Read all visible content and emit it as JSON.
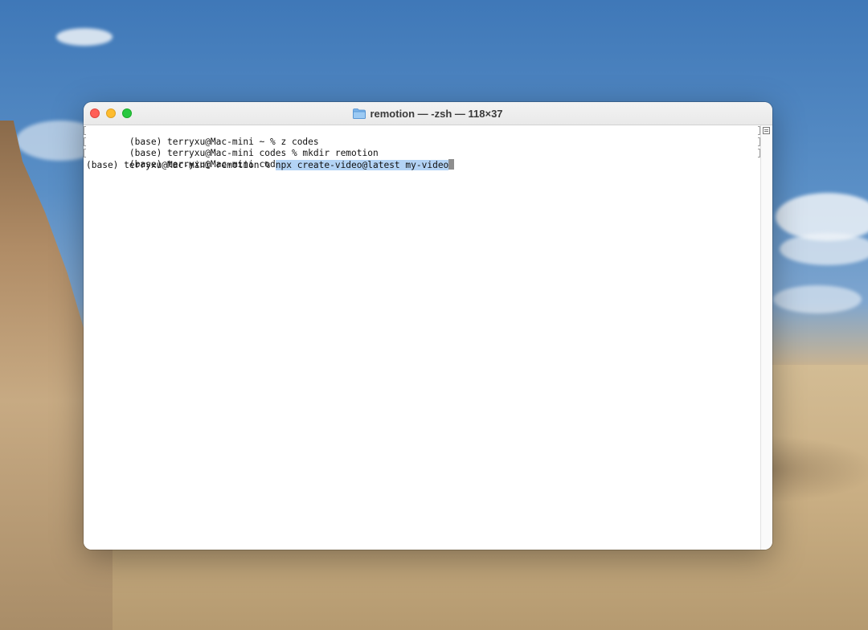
{
  "window": {
    "title": "remotion — -zsh — 118×37",
    "folder_icon": "folder-icon"
  },
  "terminal": {
    "lines": [
      {
        "text": "(base) terryxu@Mac-mini ~ % z codes"
      },
      {
        "text": "(base) terryxu@Mac-mini codes % mkdir remotion"
      },
      {
        "text": "(base) terryxu@Mac-mini codes % cd remotion"
      },
      {
        "prompt": "(base) terryxu@Mac-mini remotion % ",
        "command": "npx create-video@latest my-video"
      }
    ]
  },
  "colors": {
    "selection": "#b3d3f5",
    "close": "#ff5f57",
    "minimize": "#febc2e",
    "maximize": "#28c840"
  }
}
